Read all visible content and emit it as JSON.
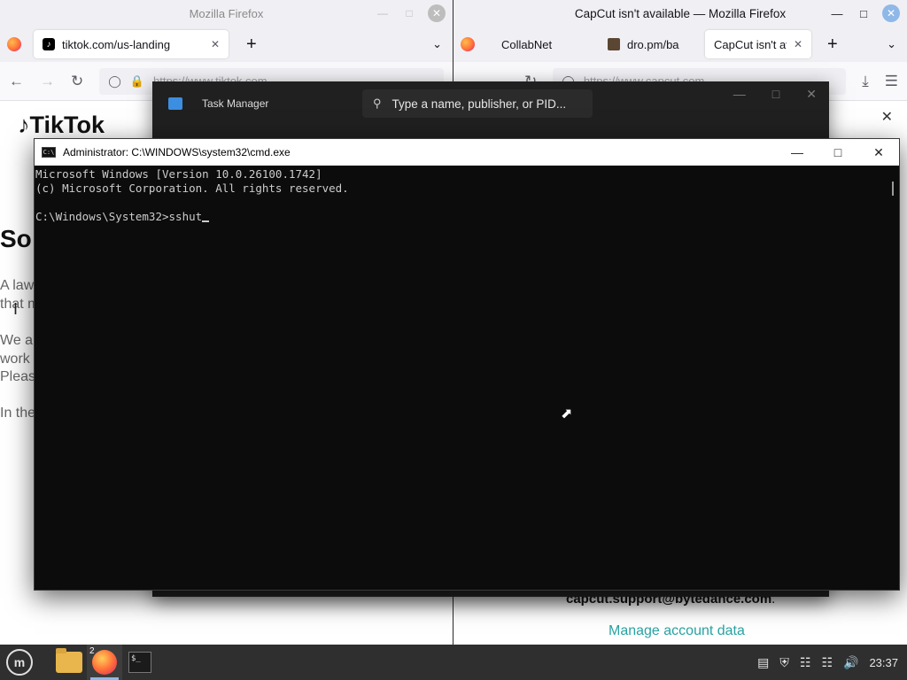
{
  "left_window": {
    "title": "Mozilla Firefox",
    "tabs": [
      {
        "label": "tiktok.com/us-landing"
      }
    ],
    "url": "https://www.tiktok.com",
    "page": {
      "logo": "TikTok",
      "heading": "So",
      "lines": [
        "A law",
        "that m",
        "We a",
        "work",
        "Pleas",
        "In the"
      ]
    }
  },
  "right_window": {
    "title": "CapCut isn't available — Mozilla Firefox",
    "tabs": [
      {
        "label": "CollabNet"
      },
      {
        "label": "dro.pm/ba"
      },
      {
        "label": "CapCut isn't av"
      }
    ],
    "url": "https://www.capcut.com",
    "page": {
      "email": "capcut.support@bytedance.com",
      "email_suffix": ".",
      "link": "Manage account data"
    }
  },
  "task_manager": {
    "title": "Task Manager",
    "search_placeholder": "Type a name, publisher, or PID..."
  },
  "cmd": {
    "title": "Administrator: C:\\WINDOWS\\system32\\cmd.exe",
    "lines": [
      "Microsoft Windows [Version 10.0.26100.1742]",
      "(c) Microsoft Corporation. All rights reserved.",
      ""
    ],
    "prompt": "C:\\Windows\\System32>",
    "input": "sshut"
  },
  "taskbar": {
    "firefox_badge": "2",
    "clock": "23:37"
  },
  "colors": {
    "accent": "#8fb8e8",
    "link": "#2aa3a3",
    "cmd_bg": "#0c0c0c",
    "taskmgr_bg": "#202020"
  }
}
